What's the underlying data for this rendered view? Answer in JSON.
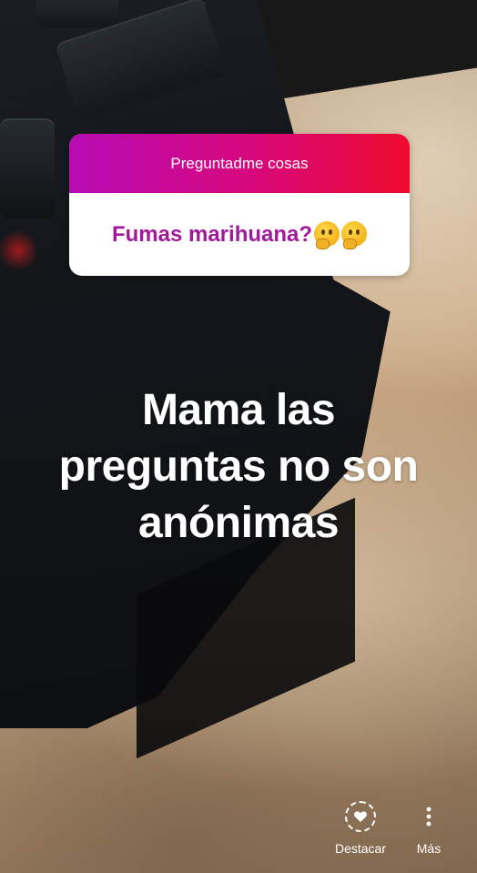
{
  "question_sticker": {
    "header": "Preguntadme cosas",
    "question": "Fumas marihuana?"
  },
  "caption": {
    "line1": "Mama las",
    "line2": "preguntas no son",
    "line3": "anónimas"
  },
  "actions": {
    "highlight_label": "Destacar",
    "more_label": "Más"
  },
  "icons": {
    "highlight": "heart-circle-icon",
    "more": "vertical-dots-icon",
    "emoji": "thinking-face-emoji"
  },
  "colors": {
    "sticker_gradient_start": "#b70bb5",
    "sticker_gradient_end": "#ef0a2e",
    "question_text": "#a3189b"
  }
}
